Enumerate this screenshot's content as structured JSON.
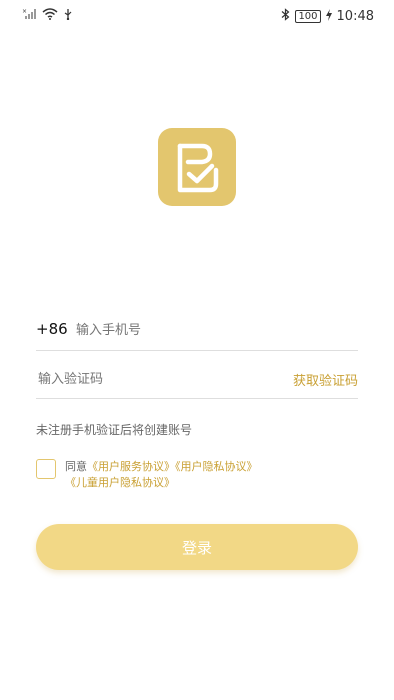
{
  "status_bar": {
    "time": "10:48",
    "battery": "100",
    "icons": [
      "signal-icon",
      "wifi-icon",
      "usb-icon",
      "bluetooth-icon",
      "battery-icon",
      "charging-icon"
    ]
  },
  "app": {
    "logo_icon": "checklist-app-logo",
    "brand_color": "#e3c66e",
    "accent_text_color": "#c9a033",
    "button_color": "#f2d886"
  },
  "login": {
    "country_code": "+86",
    "phone_placeholder": "输入手机号",
    "code_placeholder": "输入验证码",
    "get_code_label": "获取验证码",
    "hint": "未注册手机验证后将创建账号",
    "agree_prefix": "同意",
    "agreements": [
      "《用户服务协议》",
      "《用户隐私协议》",
      "《儿童用户隐私协议》"
    ],
    "login_label": "登录"
  }
}
